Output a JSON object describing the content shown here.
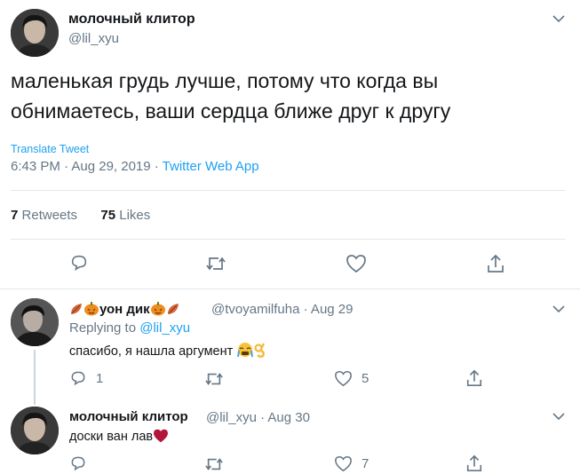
{
  "colors": {
    "link": "#1da1f2",
    "muted": "#657786",
    "text": "#14171a",
    "divider": "#e1e8ed",
    "heart": "#b3163a"
  },
  "main_tweet": {
    "display_name": "молочный клитор",
    "handle": "@lil_xyu",
    "text": "маленькая грудь лучше, потому что когда вы обнимаетесь, ваши сердца ближе друг к другу",
    "translate_label": "Translate Tweet",
    "time_date": "6:43 PM · Aug 29, 2019 · ",
    "source": "Twitter Web App",
    "retweets_count": "7",
    "retweets_label": "Retweets",
    "likes_count": "75",
    "likes_label": "Likes",
    "icons": [
      "reply-icon",
      "retweet-icon",
      "like-icon",
      "share-icon"
    ]
  },
  "replies": [
    {
      "display_name": "уон дик",
      "handle_date": "@tvoyamilfuha · Aug 29",
      "replying_prefix": "Replying to ",
      "replying_to": "@lil_xyu",
      "text": "спасибо, я нашла аргумент",
      "reply_count": "1",
      "retweet_count": "",
      "like_count": "5",
      "emoji": [
        "leaf-icon",
        "pumpkin-icon",
        "crying-face-icon",
        "ok-hand-icon"
      ]
    },
    {
      "display_name": "молочный клитор",
      "handle_date": "@lil_xyu · Aug 30",
      "text": "доски ван лав",
      "reply_count": "",
      "retweet_count": "",
      "like_count": "7",
      "emoji": [
        "red-heart-icon"
      ]
    }
  ]
}
